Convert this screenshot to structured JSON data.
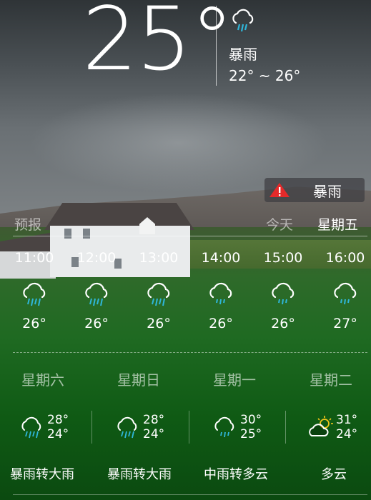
{
  "current": {
    "temperature": "25°",
    "condition": "暴雨",
    "range": "22° ~ 26°",
    "icon": "rain-cloud-icon"
  },
  "alert": {
    "label": "暴雨",
    "icon": "warning-triangle-icon",
    "color": "#e52a2a"
  },
  "tabs": {
    "forecast_label": "预报",
    "today": "今天",
    "friday": "星期五"
  },
  "hourly": [
    {
      "time": "11:00",
      "temp": "26°",
      "icon": "heavy-rain-icon"
    },
    {
      "time": "12:00",
      "temp": "26°",
      "icon": "heavy-rain-icon"
    },
    {
      "time": "13:00",
      "temp": "26°",
      "icon": "heavy-rain-icon"
    },
    {
      "time": "14:00",
      "temp": "26°",
      "icon": "moderate-rain-icon"
    },
    {
      "time": "15:00",
      "temp": "26°",
      "icon": "moderate-rain-icon"
    },
    {
      "time": "16:00",
      "temp": "27°",
      "icon": "moderate-rain-icon"
    }
  ],
  "daily": [
    {
      "weekday": "星期六",
      "high": "28°",
      "low": "24°",
      "condition": "暴雨转大雨",
      "icon": "heavy-rain-icon"
    },
    {
      "weekday": "星期日",
      "high": "28°",
      "low": "24°",
      "condition": "暴雨转大雨",
      "icon": "heavy-rain-icon"
    },
    {
      "weekday": "星期一",
      "high": "30°",
      "low": "25°",
      "condition": "中雨转多云",
      "icon": "moderate-rain-icon"
    },
    {
      "weekday": "星期二",
      "high": "31°",
      "low": "24°",
      "condition": "多云",
      "icon": "partly-cloudy-icon"
    }
  ],
  "colors": {
    "rain_drops": "#2fb6d9",
    "sun": "#f0c419"
  }
}
